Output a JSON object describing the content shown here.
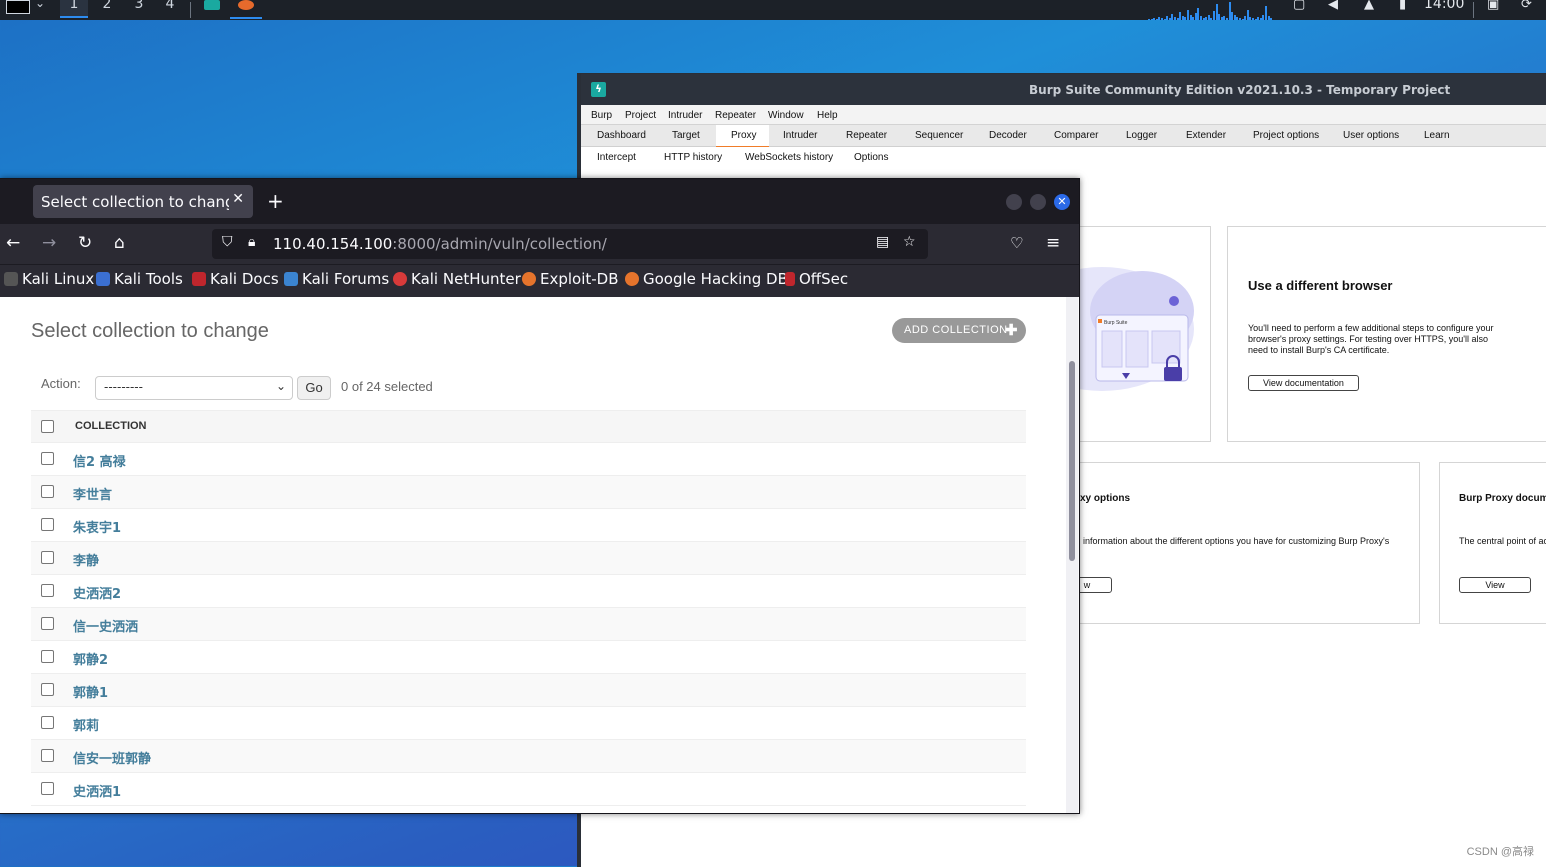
{
  "taskbar": {
    "workspaces": [
      "1",
      "2",
      "3",
      "4"
    ],
    "clock": "14:00"
  },
  "burp": {
    "title": "Burp Suite Community Edition v2021.10.3 - Temporary Project",
    "menu": [
      "Burp",
      "Project",
      "Intruder",
      "Repeater",
      "Window",
      "Help"
    ],
    "tabs": [
      "Dashboard",
      "Target",
      "Proxy",
      "Intruder",
      "Repeater",
      "Sequencer",
      "Decoder",
      "Comparer",
      "Logger",
      "Extender",
      "Project options",
      "User options",
      "Learn"
    ],
    "active_tab": "Proxy",
    "subtabs": [
      "Intercept",
      "HTTP history",
      "WebSockets history",
      "Options"
    ],
    "active_subtab": "Intercept",
    "card_browser": {
      "title": "Use a different browser",
      "text": "You'll need to perform a few additional steps to configure your browser's proxy settings. For testing over HTTPS, you'll also need to install Burp's CA certificate.",
      "button": "View documentation"
    },
    "card_options": {
      "title": "xy options",
      "text": "information about the different options you have for customizing Burp Proxy's",
      "button": "w"
    },
    "card_docs": {
      "title": "Burp Proxy docume",
      "text": "The central point of ac",
      "button": "View"
    },
    "illustration_label": "Burp Suite",
    "watermark": "CSDN @高禄"
  },
  "firefox": {
    "tab_title": "Select collection to change | Dj",
    "url_host": "110.40.154.100",
    "url_rest": ":8000/admin/vuln/collection/",
    "bookmarks": [
      "Kali Linux",
      "Kali Tools",
      "Kali Docs",
      "Kali Forums",
      "Kali NetHunter",
      "Exploit-DB",
      "Google Hacking DB",
      "OffSec"
    ]
  },
  "admin": {
    "title": "Select collection to change",
    "add_button": "ADD COLLECTION",
    "action_label": "Action:",
    "action_value": "---------",
    "go_button": "Go",
    "selected_count": "0 of 24 selected",
    "column_header": "COLLECTION",
    "rows": [
      "信2 高禄",
      "李世言",
      "朱衷宇1",
      "李静",
      "史洒洒2",
      "信一史洒洒",
      "郭静2",
      "郭静1",
      "郭莉",
      "信安一班郭静",
      "史洒洒1"
    ]
  },
  "colors": {
    "burp_accent": "#f07c29",
    "django_link": "#447e9b",
    "firefox_accent": "#2b6ae8"
  }
}
